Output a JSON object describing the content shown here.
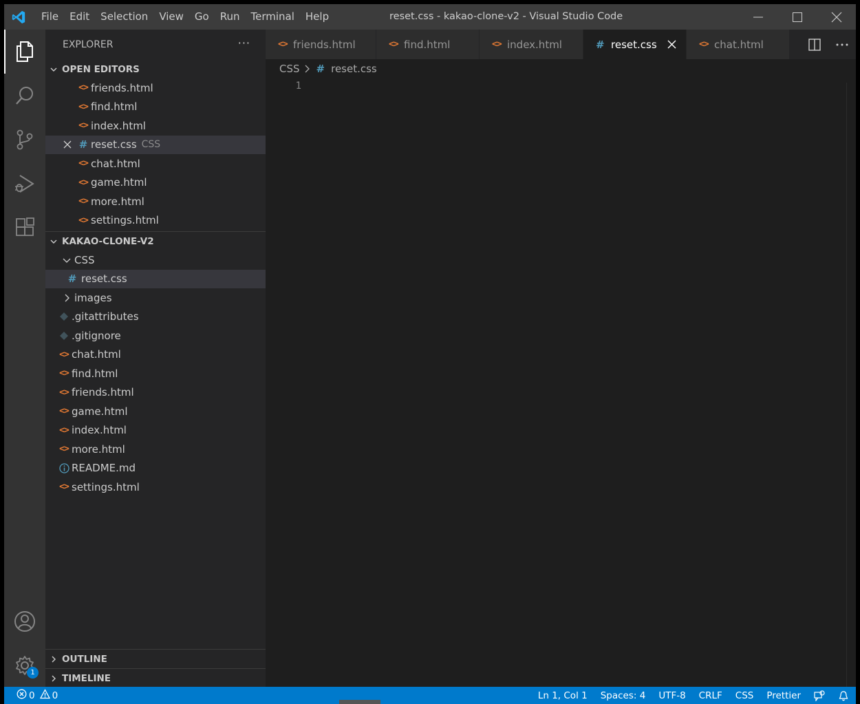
{
  "titlebar": {
    "menu": [
      "File",
      "Edit",
      "Selection",
      "View",
      "Go",
      "Run",
      "Terminal",
      "Help"
    ],
    "title": "reset.css - kakao-clone-v2 - Visual Studio Code"
  },
  "activity_bar": {
    "items": [
      "files-icon",
      "search-icon",
      "source-control-icon",
      "run-debug-icon",
      "extensions-icon"
    ],
    "bottom_items": [
      "account-icon",
      "settings-gear-icon"
    ],
    "settings_badge": "1"
  },
  "sidebar": {
    "title": "EXPLORER",
    "more": "···",
    "open_editors": {
      "header": "OPEN EDITORS",
      "items": [
        {
          "label": "friends.html",
          "type": "html"
        },
        {
          "label": "find.html",
          "type": "html"
        },
        {
          "label": "index.html",
          "type": "html"
        },
        {
          "label": "reset.css",
          "type": "css",
          "desc": "CSS"
        },
        {
          "label": "chat.html",
          "type": "html"
        },
        {
          "label": "game.html",
          "type": "html"
        },
        {
          "label": "more.html",
          "type": "html"
        },
        {
          "label": "settings.html",
          "type": "html"
        }
      ]
    },
    "project": {
      "header": "KAKAO-CLONE-V2",
      "css_folder": "CSS",
      "css_file": "reset.css",
      "images_folder": "images",
      "files": [
        {
          "label": ".gitattributes",
          "type": "git"
        },
        {
          "label": ".gitignore",
          "type": "git"
        },
        {
          "label": "chat.html",
          "type": "html"
        },
        {
          "label": "find.html",
          "type": "html"
        },
        {
          "label": "friends.html",
          "type": "html"
        },
        {
          "label": "game.html",
          "type": "html"
        },
        {
          "label": "index.html",
          "type": "html"
        },
        {
          "label": "more.html",
          "type": "html"
        },
        {
          "label": "README.md",
          "type": "info"
        },
        {
          "label": "settings.html",
          "type": "html"
        }
      ]
    },
    "outline": "OUTLINE",
    "timeline": "TIMELINE"
  },
  "editor": {
    "tabs": [
      {
        "label": "friends.html",
        "type": "html"
      },
      {
        "label": "find.html",
        "type": "html"
      },
      {
        "label": "index.html",
        "type": "html"
      },
      {
        "label": "reset.css",
        "type": "css",
        "active": true
      },
      {
        "label": "chat.html",
        "type": "html"
      }
    ],
    "breadcrumb": {
      "folder": "CSS",
      "file": "reset.css"
    },
    "line_number": "1"
  },
  "statusbar": {
    "errors": "0",
    "warnings": "0",
    "position": "Ln 1, Col 1",
    "spaces": "Spaces: 4",
    "encoding": "UTF-8",
    "eol": "CRLF",
    "language": "CSS",
    "formatter": "Prettier"
  },
  "colors": {
    "accent": "#007acc",
    "html_icon": "#e37933",
    "css_icon": "#519aba"
  }
}
